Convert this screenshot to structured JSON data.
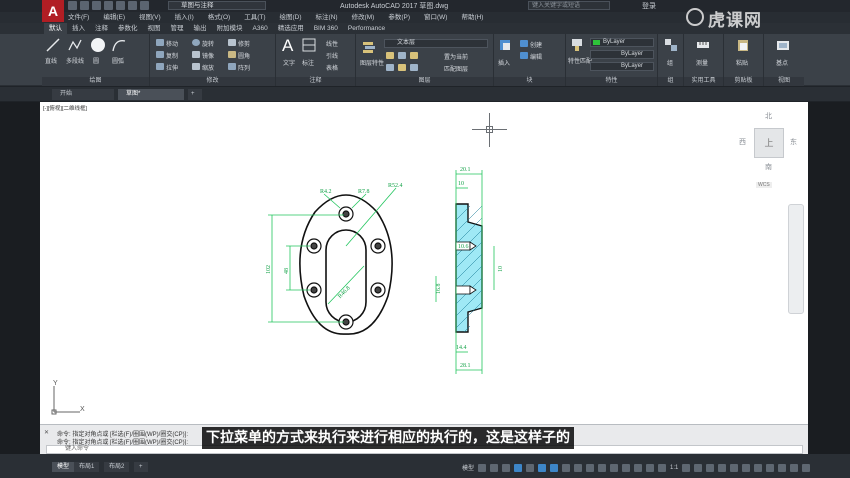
{
  "title_bar": {
    "logo": "A",
    "workspace": "草图与注释",
    "window_title": "Autodesk AutoCAD 2017    草图.dwg",
    "search_placeholder": "键入关键字或短语",
    "login": "登录",
    "watermark": "虎课网"
  },
  "menu": [
    "文件(F)",
    "编辑(E)",
    "视图(V)",
    "插入(I)",
    "格式(O)",
    "工具(T)",
    "绘图(D)",
    "标注(N)",
    "修改(M)",
    "参数(P)",
    "窗口(W)",
    "帮助(H)"
  ],
  "ribbon_tabs": [
    "默认",
    "插入",
    "注释",
    "参数化",
    "视图",
    "管理",
    "输出",
    "附加模块",
    "A360",
    "精选应用",
    "BIM 360",
    "Performance"
  ],
  "ribbon": {
    "draw": {
      "title": "绘图",
      "line": "直线",
      "polyline": "多段线",
      "circle": "圆",
      "arc": "圆弧"
    },
    "modify": {
      "title": "修改",
      "move": "移动",
      "rotate": "旋转",
      "trim": "修剪",
      "copy": "复制",
      "mirror": "镜像",
      "fillet": "圆角",
      "stretch": "拉伸",
      "scale": "缩放",
      "array": "阵列"
    },
    "annotation": {
      "title": "注释",
      "text": "文字",
      "dimension": "标注",
      "linear": "线性",
      "leader": "引线",
      "table": "表格"
    },
    "layers": {
      "title": "图层",
      "properties": "图层特性",
      "current_layer": "文本层",
      "make_current": "置为当前",
      "match": "匹配图层"
    },
    "block": {
      "title": "块",
      "insert": "插入",
      "create": "创建",
      "edit": "编辑"
    },
    "properties": {
      "title": "特性",
      "match": "特性匹配",
      "color": "ByLayer",
      "linetype": "ByLayer",
      "lineweight": "ByLayer"
    },
    "groups": {
      "title": "组",
      "group": "组"
    },
    "utilities": {
      "title": "实用工具",
      "measure": "测量"
    },
    "clipboard": {
      "title": "剪贴板",
      "paste": "粘贴"
    },
    "view": {
      "title": "视图",
      "base": "基点"
    }
  },
  "file_tabs": [
    "开始",
    "草图*"
  ],
  "viewport": {
    "label": "[-][俯视][二维线框]",
    "compass": {
      "north": "北",
      "south": "南",
      "east": "东",
      "west": "西",
      "top": "上"
    },
    "wcs": "WCS",
    "ucs_x": "X",
    "ucs_y": "Y"
  },
  "drawing": {
    "front_dims": [
      "R4.2",
      "R7.8",
      "R52.4",
      "102",
      "48",
      "R46.8"
    ],
    "side_dims": [
      "20.1",
      "10",
      "10.6",
      "10",
      "16.8",
      "14.4",
      "28.1"
    ]
  },
  "command": {
    "history": [
      "命令: 指定对角点或 [栏选(F)/圈围(WP)/圈交(CP)]:",
      "命令: 指定对角点或 [栏选(F)/圈围(WP)/圈交(CP)]:"
    ],
    "input_placeholder": "键入命令"
  },
  "subtitle": "下拉菜单的方式来执行来进行相应的执行的，这是这样子的",
  "layouts": [
    "模型",
    "布局1",
    "布局2"
  ],
  "status": {
    "mode": "模型",
    "scale": "1:1"
  }
}
